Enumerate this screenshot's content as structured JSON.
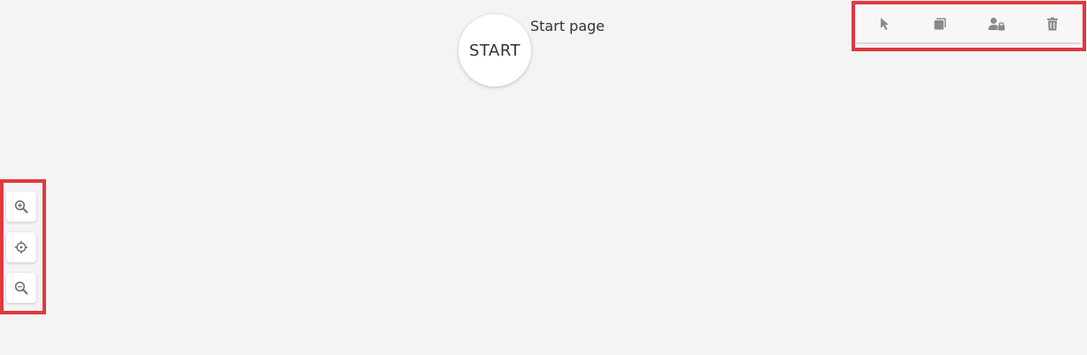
{
  "canvas": {
    "start_node": {
      "text": "START",
      "label": "Start page"
    }
  },
  "toolbar": {
    "buttons": [
      {
        "name": "select",
        "icon": "cursor-pointer-icon"
      },
      {
        "name": "duplicate",
        "icon": "copy-icon"
      },
      {
        "name": "permissions",
        "icon": "user-lock-icon"
      },
      {
        "name": "delete",
        "icon": "trash-icon"
      }
    ]
  },
  "zoom_controls": {
    "buttons": [
      {
        "name": "zoom-in",
        "icon": "zoom-in-icon"
      },
      {
        "name": "recenter",
        "icon": "crosshair-icon"
      },
      {
        "name": "zoom-out",
        "icon": "zoom-out-icon"
      }
    ]
  },
  "colors": {
    "background": "#f4f4f4",
    "highlight": "#e0383e",
    "icon": "#8a8a8a",
    "text": "#333333"
  }
}
